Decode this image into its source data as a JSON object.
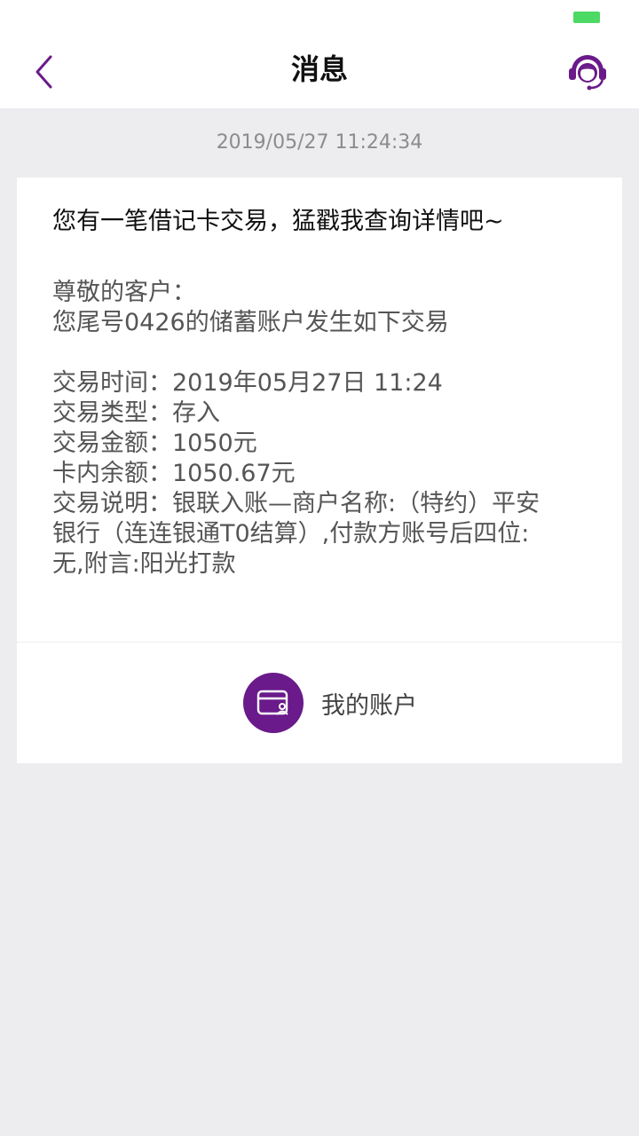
{
  "theme": {
    "accent": "#6a1a8a",
    "battery": "#4cd964"
  },
  "status_bar": {
    "battery_icon": "battery-icon"
  },
  "nav": {
    "back_icon": "chevron-left-icon",
    "title": "消息",
    "service_icon": "customer-service-icon"
  },
  "message": {
    "timestamp": "2019/05/27 11:24:34",
    "headline": "您有一笔借记卡交易，猛戳我查询详情吧~",
    "greeting": "尊敬的客户：",
    "intro": "您尾号0426的储蓄账户发生如下交易",
    "details": [
      "交易时间：2019年05月27日  11:24",
      "交易类型：存入",
      "交易金额：1050元",
      "卡内余额：1050.67元",
      "交易说明：银联入账—商户名称:（特约）平安",
      "银行（连连银通T0结算）,付款方账号后四位:",
      "无,附言:阳光打款"
    ],
    "account_link": {
      "icon": "account-card-icon",
      "label": "我的账户"
    }
  }
}
